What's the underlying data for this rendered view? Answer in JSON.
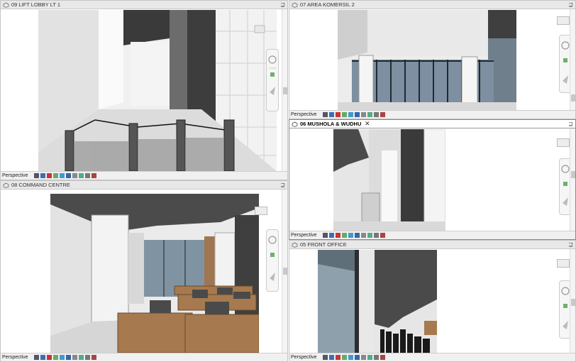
{
  "views": {
    "lift_lobby": {
      "title": "09 LIFT LOBBY LT 1",
      "mode": "Perspective"
    },
    "area_komersil": {
      "title": "07 AREA KOMERSIL 2",
      "mode": "Perspective"
    },
    "mushola": {
      "title": "06 MUSHOLA & WUDHU",
      "mode": "Perspective",
      "close": "✕"
    },
    "command_centre": {
      "title": "08 COMMAND CENTRE",
      "mode": "Perspective"
    },
    "front_office": {
      "title": "05 FRONT OFFICE",
      "mode": "Perspective"
    }
  },
  "controls": {
    "restore": "⊒"
  },
  "colors": {
    "titlebar": "#e8e8e8",
    "wall_dark": "#3a3a3a",
    "glass": "#7a8ea0",
    "wood": "#a67a4e"
  }
}
